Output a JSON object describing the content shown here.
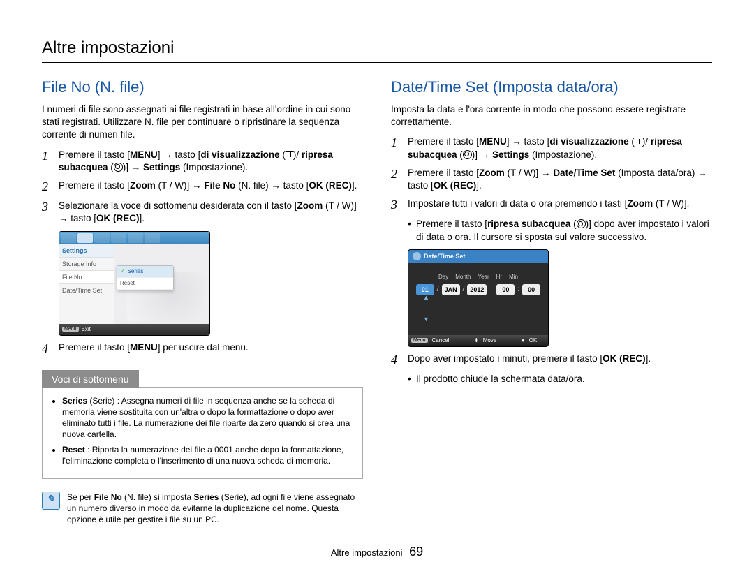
{
  "page_title": "Altre impostazioni",
  "footer_text": "Altre impostazioni",
  "page_number": "69",
  "left": {
    "heading": "File No (N. file)",
    "intro": "I numeri di file sono assegnati ai file registrati in base all'ordine in cui sono stati registrati. Utilizzare N. file per continuare o ripristinare la sequenza corrente di numeri file.",
    "step1_a": "Premere il tasto [",
    "step1_menu": "MENU",
    "step1_b": "] → tasto [",
    "step1_disp": "di visualizzazione",
    "step1_c": " (",
    "step1_d": ")/ ",
    "step1_sub": "ripresa subacquea",
    "step1_e": " (",
    "step1_f": ")] → ",
    "step1_settings": "Settings",
    "step1_g": " (Impostazione).",
    "step2_a": "Premere il tasto [",
    "step2_zoom": "Zoom",
    "step2_tw": " (T / W)",
    "step2_b": "] → ",
    "step2_fileno": "File No",
    "step2_c": " (N. file) → tasto [",
    "step2_okrec": "OK (REC)",
    "step2_d": "].",
    "step3_a": "Selezionare la voce di sottomenu desiderata con il tasto [",
    "step3_zoom": "Zoom",
    "step3_tw": " (T / W)",
    "step3_b": "] → tasto [",
    "step3_okrec": "OK (REC)",
    "step3_c": "].",
    "step4_a": "Premere il tasto [",
    "step4_menu": "MENU",
    "step4_b": "] per uscire dal menu.",
    "sub_title": "Voci di sottomenu",
    "sub1_head": "Series",
    "sub1_paren": " (Serie) : ",
    "sub1_text": "Assegna numeri di file in sequenza anche se la scheda di memoria viene sostituita con un'altra o dopo la formattazione o dopo aver eliminato tutti i file. La numerazione dei file riparte da zero quando si crea una nuova cartella.",
    "sub2_head": "Reset",
    "sub2_paren": " : ",
    "sub2_text": "Riporta la numerazione dei file a 0001 anche dopo la formattazione, l'eliminazione completa o l'inserimento di una nuova scheda di memoria.",
    "note_a": "Se per ",
    "note_fileno": "File No",
    "note_b": " (N. file) si imposta ",
    "note_series": "Series",
    "note_c": " (Serie), ad ogni file viene assegnato un numero diverso in modo da evitarne la duplicazione del nome. Questa opzione è utile per gestire i file su un PC.",
    "ui": {
      "settings": "Settings",
      "storage": "Storage Info",
      "fileno": "File No",
      "datetime": "Date/Time Set",
      "pop_series": "Series",
      "pop_reset": "Reset",
      "exit_chip": "Menu",
      "exit": "Exit"
    }
  },
  "right": {
    "heading": "Date/Time Set (Imposta data/ora)",
    "intro": "Imposta la data e l'ora corrente in modo che possono essere registrate correttamente.",
    "step1_a": "Premere il tasto [",
    "step1_menu": "MENU",
    "step1_b": "] → tasto [",
    "step1_disp": "di visualizzazione",
    "step1_c": " (",
    "step1_d": ")/ ",
    "step1_sub": "ripresa subacquea",
    "step1_e": " (",
    "step1_f": ")] → ",
    "step1_settings": "Settings",
    "step1_g": " (Impostazione).",
    "step2_a": "Premere il tasto [",
    "step2_zoom": "Zoom",
    "step2_tw": " (T / W)",
    "step2_b": "] → ",
    "step2_dts": "Date/Time Set",
    "step2_c": " (Imposta data/ora) → tasto [",
    "step2_okrec": "OK (REC)",
    "step2_d": "].",
    "step3_a": "Impostare tutti i valori di data o ora premendo i tasti [",
    "step3_zoom": "Zoom",
    "step3_tw": " (T / W)",
    "step3_b": "].",
    "step3_bullet_a": "Premere il tasto [",
    "step3_bullet_sub": "ripresa subacquea",
    "step3_bullet_b": " (",
    "step3_bullet_c": ")] dopo aver impostato i valori di data o ora. Il cursore si sposta sul valore successivo.",
    "step4_a": "Dopo aver impostato i minuti, premere il tasto [",
    "step4_okrec": "OK (REC)",
    "step4_b": "].",
    "step4_bullet": "Il prodotto chiude la schermata data/ora.",
    "ui": {
      "title": "Date/Time Set",
      "lbl_day": "Day",
      "lbl_month": "Month",
      "lbl_year": "Year",
      "lbl_hr": "Hr",
      "lbl_min": "Min",
      "v_day": "01",
      "v_month": "JAN",
      "v_year": "2012",
      "v_hr": "00",
      "v_min": "00",
      "cancel_chip": "Menu",
      "cancel": "Cancel",
      "move": "Move",
      "ok": "OK"
    }
  }
}
